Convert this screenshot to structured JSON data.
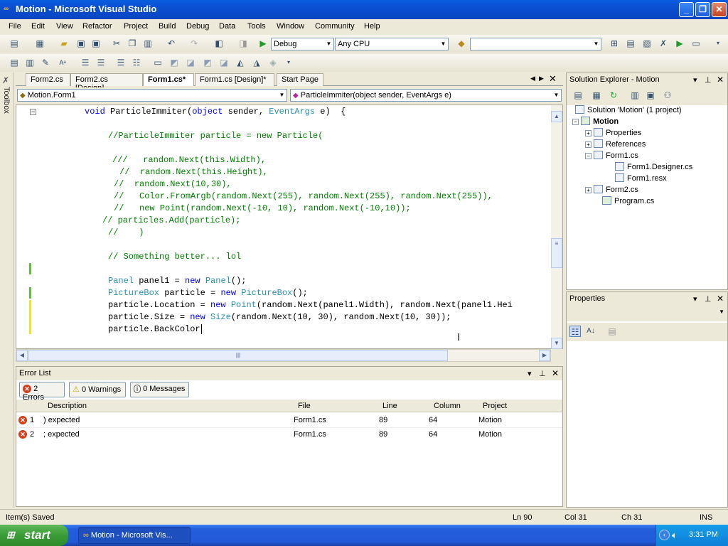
{
  "window": {
    "title": "Motion - Microsoft Visual Studio"
  },
  "menu": [
    "File",
    "Edit",
    "View",
    "Refactor",
    "Project",
    "Build",
    "Debug",
    "Data",
    "Tools",
    "Window",
    "Community",
    "Help"
  ],
  "toolbar": {
    "config": "Debug",
    "platform": "Any CPU",
    "find": ""
  },
  "toolbox_label": "Toolbox",
  "tabs": [
    "Form2.cs",
    "Form2.cs [Design]",
    "Form1.cs*",
    "Form1.cs [Design]*",
    "Start Page"
  ],
  "nav": {
    "class_combo": "Motion.Form1",
    "member_combo": "ParticleImmiter(object sender, EventArgs e)"
  },
  "code": {
    "line1": {
      "kw": "void",
      "name": " ParticleImmiter(",
      "kw2": "object",
      "mid": " sender, ",
      "ty": "EventArgs",
      "end": " e)  {"
    },
    "c1": "//ParticleImmiter particle = new Particle(",
    "c2": "///   random.Next(this.Width),",
    "c3": "//  random.Next(this.Height),",
    "c4": "//  random.Next(10,30),",
    "c5": "//   Color.FromArgb(random.Next(255), random.Next(255), random.Next(255)),",
    "c6": "//   new Point(random.Next(-10, 10), random.Next(-10,10));",
    "c7": "// particles.Add(particle);",
    "c8": "//    )",
    "c9": "// Something better... lol",
    "l10": {
      "ty": "Panel",
      "a": " panel1 = ",
      "kw": "new",
      "ty2": " Panel",
      "b": "();"
    },
    "l11": {
      "ty": "PictureBox",
      "a": " particle = ",
      "kw": "new",
      "ty2": " PictureBox",
      "b": "();"
    },
    "l12": {
      "a": "particle.Location = ",
      "kw": "new",
      "ty2": " Point",
      "b": "(random.Next(panel1.Width), random.Next(panel1.Hei"
    },
    "l13": {
      "a": "particle.Size = ",
      "kw": "new",
      "ty2": " Size",
      "b": "(random.Next(10, 30), random.Next(10, 30));"
    },
    "l14": "particle.BackColor"
  },
  "errorlist": {
    "title": "Error List",
    "errors_btn": "2 Errors",
    "warnings_btn": "0 Warnings",
    "messages_btn": "0 Messages",
    "columns": [
      "Description",
      "File",
      "Line",
      "Column",
      "Project"
    ],
    "rows": [
      {
        "num": "1",
        "desc": ") expected",
        "file": "Form1.cs",
        "line": "89",
        "col": "64",
        "project": "Motion"
      },
      {
        "num": "2",
        "desc": "; expected",
        "file": "Form1.cs",
        "line": "89",
        "col": "64",
        "project": "Motion"
      }
    ]
  },
  "solution": {
    "title": "Solution Explorer - Motion",
    "root": "Solution 'Motion' (1 project)",
    "project": "Motion",
    "items": [
      "Properties",
      "References",
      "Form1.cs",
      "Form1.Designer.cs",
      "Form1.resx",
      "Form2.cs",
      "Program.cs"
    ]
  },
  "properties": {
    "title": "Properties"
  },
  "status": {
    "text": "Item(s) Saved",
    "ln": "Ln 90",
    "col": "Col 31",
    "ch": "Ch 31",
    "mode": "INS"
  },
  "taskbar": {
    "start": "start",
    "item": "Motion - Microsoft Vis...",
    "time": "3:31 PM"
  }
}
